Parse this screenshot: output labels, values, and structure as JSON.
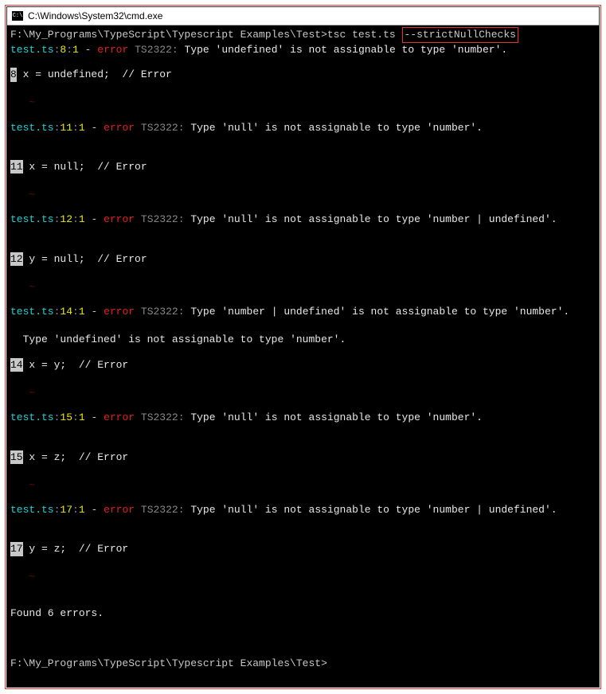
{
  "title": "C:\\Windows\\System32\\cmd.exe",
  "titlebar_icon": "C:\\",
  "prompt1": "F:\\My_Programs\\TypeScript\\Typescript Examples\\Test>",
  "cmd_part1": "tsc test.ts ",
  "cmd_flag": "--strictNullChecks",
  "errors": [
    {
      "file": "test.ts",
      "line": "8",
      "col": "1",
      "code": "TS2322",
      "msg": "Type 'undefined' is not assignable to type 'number'.",
      "lineno": "8",
      "src": " x = undefined;  // Error"
    },
    {
      "file": "test.ts",
      "line": "11",
      "col": "1",
      "code": "TS2322",
      "msg": "Type 'null' is not assignable to type 'number'.",
      "lineno": "11",
      "src": " x = null;  // Error"
    },
    {
      "file": "test.ts",
      "line": "12",
      "col": "1",
      "code": "TS2322",
      "msg": "Type 'null' is not assignable to type 'number | undefined'.",
      "lineno": "12",
      "src": " y = null;  // Error"
    },
    {
      "file": "test.ts",
      "line": "14",
      "col": "1",
      "code": "TS2322",
      "msg": "Type 'number | undefined' is not assignable to type 'number'.",
      "extra": "  Type 'undefined' is not assignable to type 'number'.",
      "lineno": "14",
      "src": " x = y;  // Error"
    },
    {
      "file": "test.ts",
      "line": "15",
      "col": "1",
      "code": "TS2322",
      "msg": "Type 'null' is not assignable to type 'number'.",
      "lineno": "15",
      "src": " x = z;  // Error"
    },
    {
      "file": "test.ts",
      "line": "17",
      "col": "1",
      "code": "TS2322",
      "msg": "Type 'null' is not assignable to type 'number | undefined'.",
      "lineno": "17",
      "src": " y = z;  // Error"
    }
  ],
  "dash": " - ",
  "error_word": "error",
  "colon": ":",
  "colon_space": ": ",
  "tilde": "~",
  "summary": "Found 6 errors.",
  "prompt2": "F:\\My_Programs\\TypeScript\\Typescript Examples\\Test>"
}
